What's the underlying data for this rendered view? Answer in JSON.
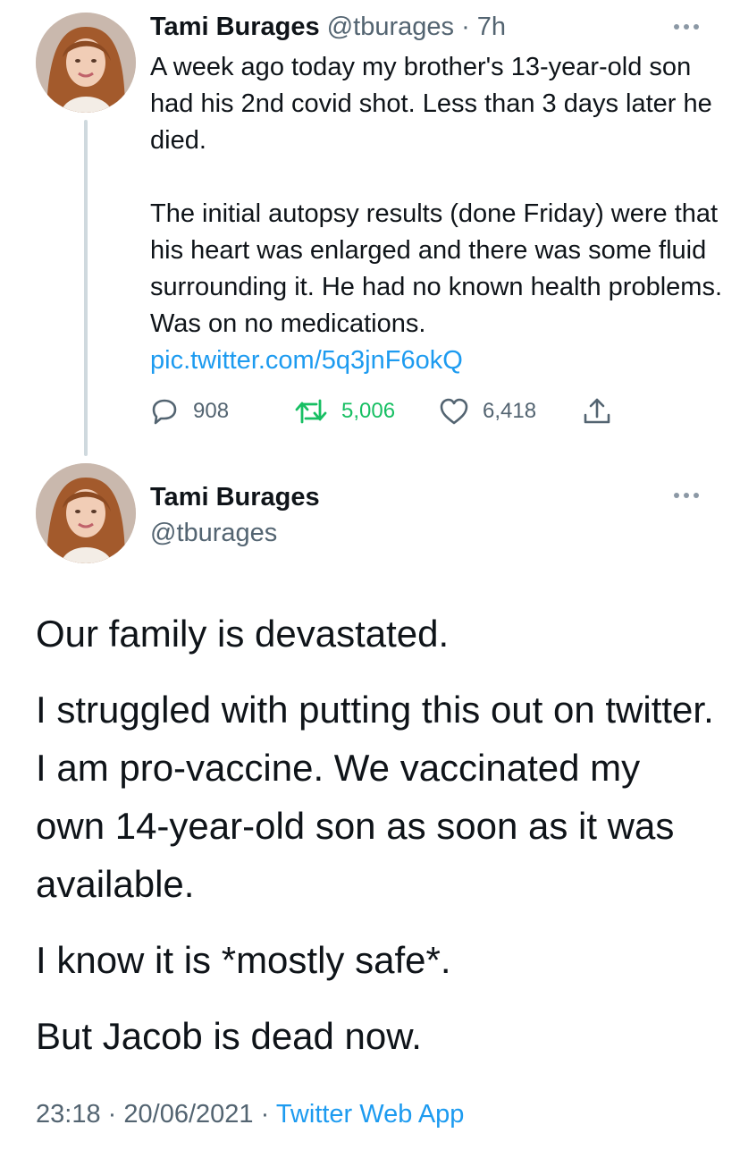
{
  "reply_tweet": {
    "author_name": "Tami Burages",
    "author_handle": "@tburages",
    "separator": "·",
    "time_ago": "7h",
    "text_para1": "A week ago today my brother's 13-year-old son had his 2nd covid shot.  Less than 3 days later he died.",
    "text_para2": "The initial autopsy results (done Friday) were that his heart was enlarged and there was some fluid surrounding it. He had no known health problems. Was on no medications.",
    "link": "pic.twitter.com/5q3jnF6okQ",
    "reply_count": "908",
    "retweet_count": "5,006",
    "like_count": "6,418",
    "icons": {
      "reply": "speech-bubble-icon",
      "retweet": "retweet-arrows-icon",
      "like": "heart-icon",
      "share": "share-upload-icon",
      "more": "more-dots-icon"
    }
  },
  "main_tweet": {
    "author_name": "Tami Burages",
    "author_handle": "@tburages",
    "paragraphs": [
      "Our family is devastated.",
      "I struggled with putting this out on twitter. I am pro-vaccine. We vaccinated my own 14-year-old son as soon as it was available.",
      "I know it is *mostly safe*.",
      "But Jacob is dead now."
    ],
    "time": "23:18",
    "separator": "·",
    "date": "20/06/2021",
    "source": "Twitter Web App"
  },
  "colors": {
    "text": "#0f1419",
    "secondary": "#536471",
    "link": "#1d9bf0",
    "retweet": "#17bf63",
    "thread_line": "#cfd9de"
  }
}
